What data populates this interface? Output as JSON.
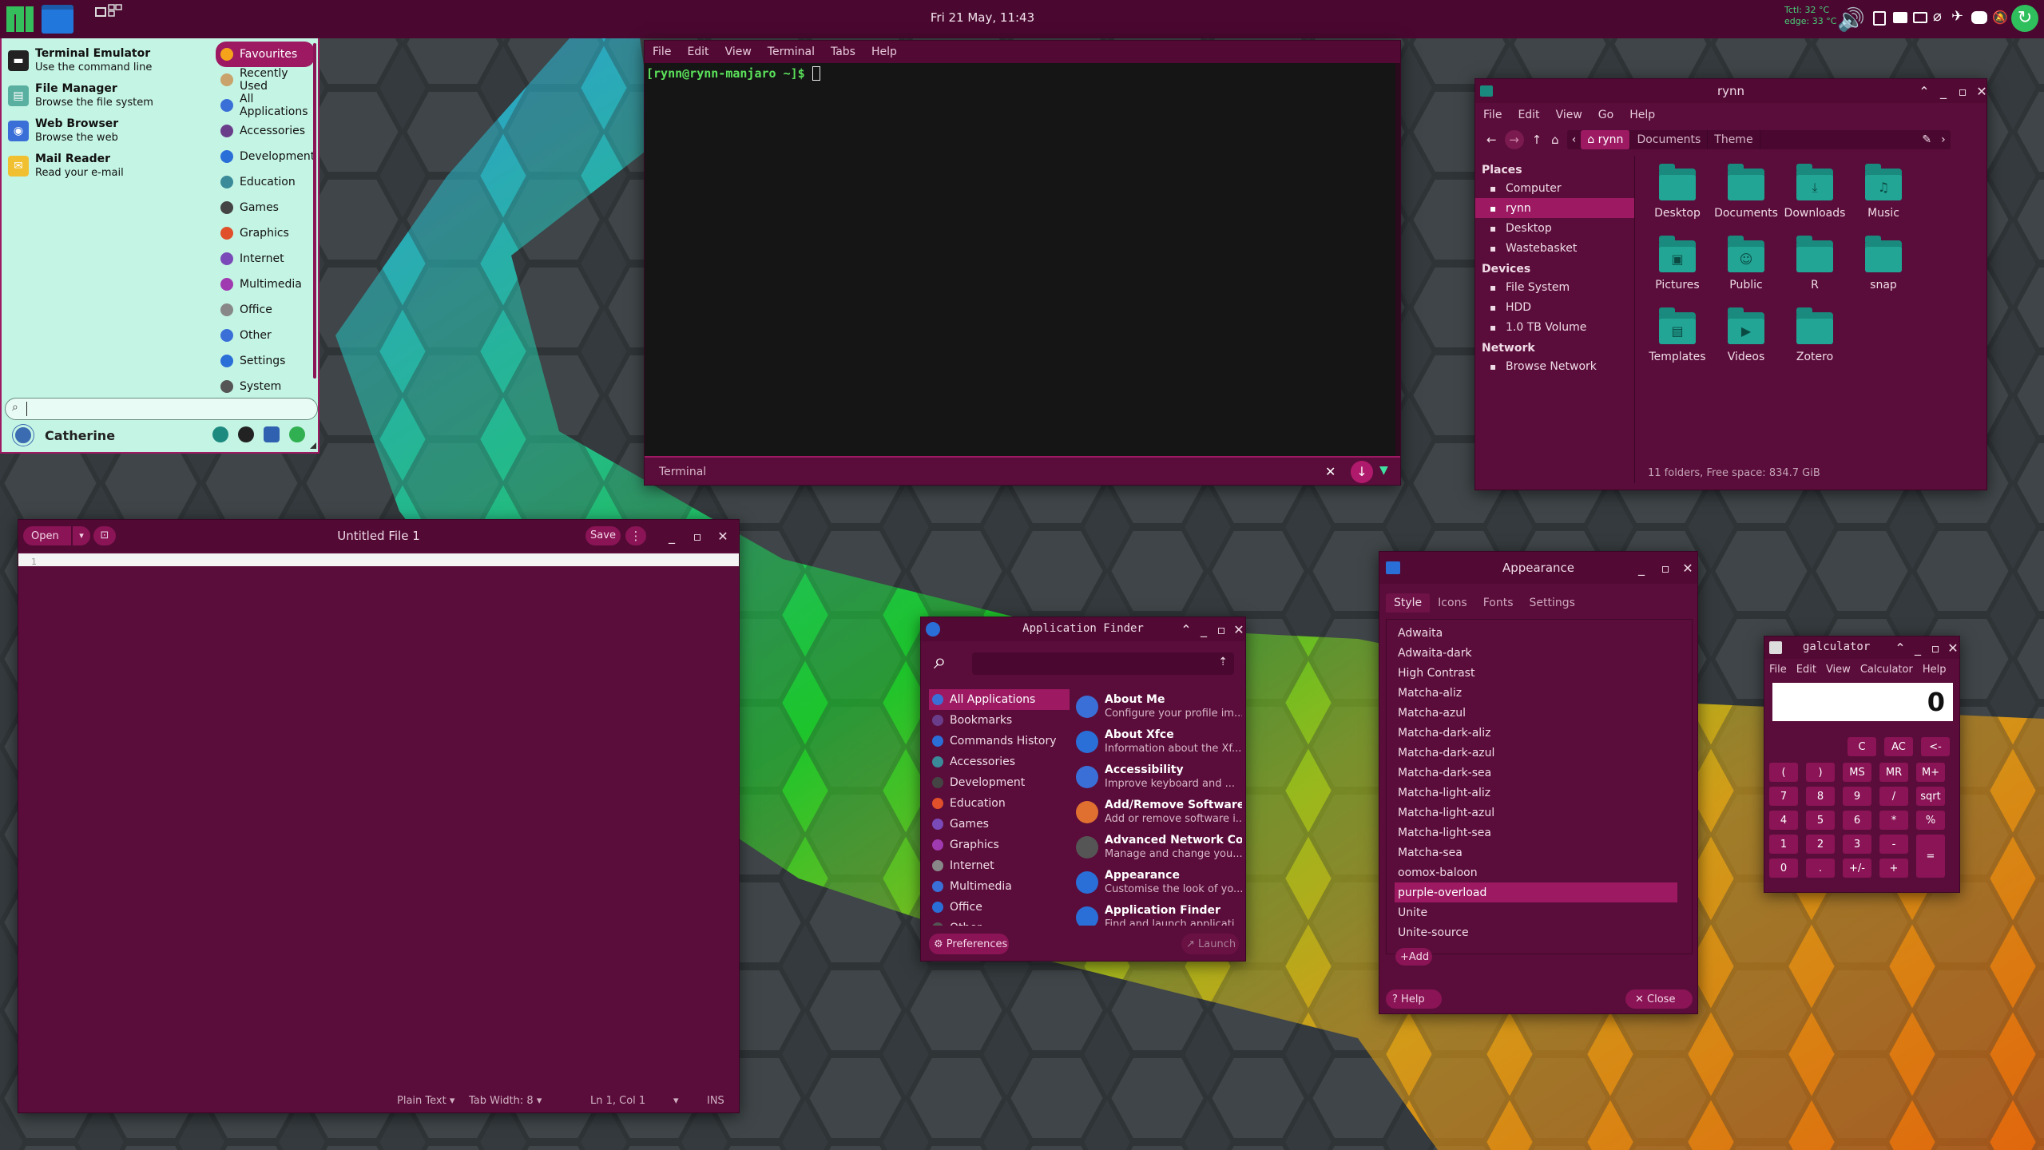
{
  "colors": {
    "panel": "#4a0830",
    "accent": "#9d1a63",
    "window": "#5a0d3a",
    "menu_bg": "#bff2e2",
    "terminal_bg": "#151515"
  },
  "panel": {
    "clock": "Fri 21 May, 11:43",
    "temp_lines": [
      "Tctl: 32 °C",
      "edge: 33 °C"
    ],
    "icons": [
      "manjaro-logo-icon",
      "desktop-icon",
      "workspaces-icon",
      "volume-icon",
      "clipboard-icon",
      "screen-icon",
      "display-icon",
      "paperclip-icon",
      "network-icon",
      "discord-icon",
      "notification-icon",
      "update-icon"
    ]
  },
  "whisker": {
    "favourites": [
      {
        "title": "Terminal Emulator",
        "desc": "Use the command line",
        "icon": "terminal-icon"
      },
      {
        "title": "File Manager",
        "desc": "Browse the file system",
        "icon": "folder-icon"
      },
      {
        "title": "Web Browser",
        "desc": "Browse the web",
        "icon": "globe-icon"
      },
      {
        "title": "Mail Reader",
        "desc": "Read your e-mail",
        "icon": "mail-icon"
      }
    ],
    "categories": [
      {
        "label": "Favourites",
        "icon": "star-icon",
        "active": true
      },
      {
        "label": "Recently Used",
        "icon": "clock-icon"
      },
      {
        "label": "All Applications",
        "icon": "apps-icon"
      },
      {
        "label": "Accessories",
        "icon": "accessories-icon"
      },
      {
        "label": "Development",
        "icon": "development-icon"
      },
      {
        "label": "Education",
        "icon": "education-icon"
      },
      {
        "label": "Games",
        "icon": "games-icon"
      },
      {
        "label": "Graphics",
        "icon": "graphics-icon"
      },
      {
        "label": "Internet",
        "icon": "internet-icon"
      },
      {
        "label": "Multimedia",
        "icon": "multimedia-icon"
      },
      {
        "label": "Office",
        "icon": "office-icon"
      },
      {
        "label": "Other",
        "icon": "other-icon"
      },
      {
        "label": "Settings",
        "icon": "settings-icon"
      },
      {
        "label": "System",
        "icon": "system-icon"
      }
    ],
    "search_value": "",
    "user": "Catherine"
  },
  "terminal": {
    "menu": [
      "File",
      "Edit",
      "View",
      "Terminal",
      "Tabs",
      "Help"
    ],
    "prompt": "[rynn@rynn-manjaro ~]$ ",
    "tab_label": "Terminal"
  },
  "files": {
    "title": "rynn",
    "menu": [
      "File",
      "Edit",
      "View",
      "Go",
      "Help"
    ],
    "path": [
      "rynn",
      "Documents",
      "Theme"
    ],
    "sections": [
      {
        "heading": "Places",
        "items": [
          {
            "label": "Computer",
            "icon": "computer-icon"
          },
          {
            "label": "rynn",
            "icon": "home-icon",
            "active": true
          },
          {
            "label": "Desktop",
            "icon": "desktop-folder-icon"
          },
          {
            "label": "Wastebasket",
            "icon": "trash-icon"
          }
        ]
      },
      {
        "heading": "Devices",
        "items": [
          {
            "label": "File System",
            "icon": "drive-icon"
          },
          {
            "label": "HDD",
            "icon": "drive-icon"
          },
          {
            "label": "1.0 TB Volume",
            "icon": "drive-icon"
          }
        ]
      },
      {
        "heading": "Network",
        "items": [
          {
            "label": "Browse Network",
            "icon": "network-icon"
          }
        ]
      }
    ],
    "folders": [
      {
        "label": "Desktop",
        "glyph": ""
      },
      {
        "label": "Documents",
        "glyph": ""
      },
      {
        "label": "Downloads",
        "glyph": "⤓"
      },
      {
        "label": "Music",
        "glyph": "♫"
      },
      {
        "label": "Pictures",
        "glyph": "▣"
      },
      {
        "label": "Public",
        "glyph": "☺"
      },
      {
        "label": "R",
        "glyph": ""
      },
      {
        "label": "snap",
        "glyph": ""
      },
      {
        "label": "Templates",
        "glyph": "▤"
      },
      {
        "label": "Videos",
        "glyph": "▶"
      },
      {
        "label": "Zotero",
        "glyph": ""
      }
    ],
    "status": "11 folders, Free space: 834.7 GiB"
  },
  "editor": {
    "open_label": "Open",
    "save_label": "Save",
    "title": "Untitled File 1",
    "line_number": "1",
    "status": {
      "syntax": "Plain Text",
      "tab_width": "Tab Width: 8",
      "position": "Ln 1, Col 1",
      "mode": "INS"
    }
  },
  "appfinder": {
    "title": "Application Finder",
    "search_value": "",
    "categories": [
      {
        "label": "All Applications",
        "active": true
      },
      {
        "label": "Bookmarks"
      },
      {
        "label": "Commands History"
      },
      {
        "label": "Accessories"
      },
      {
        "label": "Development"
      },
      {
        "label": "Education"
      },
      {
        "label": "Games"
      },
      {
        "label": "Graphics"
      },
      {
        "label": "Internet"
      },
      {
        "label": "Multimedia"
      },
      {
        "label": "Office"
      },
      {
        "label": "Other"
      }
    ],
    "apps": [
      {
        "name": "About Me",
        "desc": "Configure your profile im..."
      },
      {
        "name": "About Xfce",
        "desc": "Information about the Xf..."
      },
      {
        "name": "Accessibility",
        "desc": "Improve keyboard and ..."
      },
      {
        "name": "Add/Remove Software",
        "desc": "Add or remove software i..."
      },
      {
        "name": "Advanced Network Co...",
        "desc": "Manage and change you..."
      },
      {
        "name": "Appearance",
        "desc": "Customise the look of yo..."
      },
      {
        "name": "Application Finder",
        "desc": "Find and launch applicati..."
      }
    ],
    "preferences_label": "Preferences",
    "launch_label": "Launch"
  },
  "appearance": {
    "title": "Appearance",
    "tabs": [
      "Style",
      "Icons",
      "Fonts",
      "Settings"
    ],
    "themes": [
      "Adwaita",
      "Adwaita-dark",
      "High Contrast",
      "Matcha-aliz",
      "Matcha-azul",
      "Matcha-dark-aliz",
      "Matcha-dark-azul",
      "Matcha-dark-sea",
      "Matcha-light-aliz",
      "Matcha-light-azul",
      "Matcha-light-sea",
      "Matcha-sea",
      "oomox-baloon",
      "purple-overload",
      "Unite",
      "Unite-source"
    ],
    "selected": "purple-overload",
    "add_label": "Add",
    "help_label": "Help",
    "close_label": "Close"
  },
  "calculator": {
    "title": "galculator",
    "menu": [
      "File",
      "Edit",
      "View",
      "Calculator",
      "Help"
    ],
    "display": "0",
    "top_row": [
      "C",
      "AC",
      "<-"
    ],
    "mem_row": [
      "(",
      ")",
      "MS",
      "MR",
      "M+"
    ],
    "rows": [
      [
        "7",
        "8",
        "9",
        "/",
        "sqrt"
      ],
      [
        "4",
        "5",
        "6",
        "*",
        "%"
      ],
      [
        "1",
        "2",
        "3",
        "-"
      ],
      [
        "0",
        ".",
        "+/-",
        "+"
      ]
    ],
    "equals": "="
  }
}
